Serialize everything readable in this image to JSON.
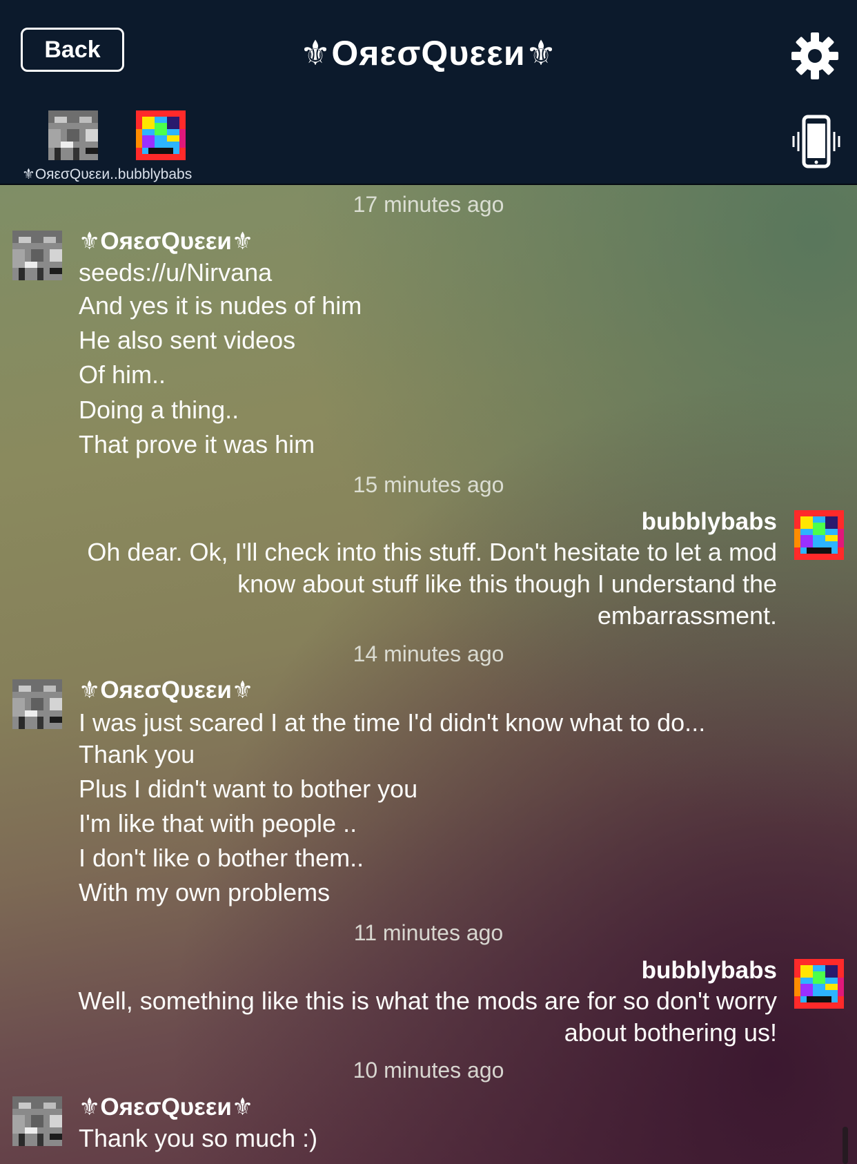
{
  "header": {
    "back_label": "Back",
    "title": "⚜OяεσQυεεи⚜",
    "settings_icon": "gear-icon",
    "vibrate_icon": "phone-vibrate-icon",
    "members_label": "⚜OяεσQυεεи..bubblybabs"
  },
  "messages": [
    {
      "time": "17 minutes ago",
      "sender": "⚜OяεσQυεεи⚜",
      "side": "left",
      "lines": [
        "seeds://u/Nirvana",
        "And yes it is nudes of him",
        "He also sent videos",
        "Of him..",
        "Doing a thing..",
        "That prove it was him"
      ]
    },
    {
      "time": "15 minutes ago",
      "sender": "bubblybabs",
      "side": "right",
      "lines": [
        "Oh dear.  Ok, I'll check into this stuff.  Don't hesitate to let a mod",
        "know about stuff like this though I understand the",
        "embarrassment."
      ]
    },
    {
      "time": "14 minutes ago",
      "sender": "⚜OяεσQυεεи⚜",
      "side": "left",
      "lines": [
        "I was just scared I at the time I'd didn't know what to do...",
        "Thank you",
        "Plus I didn't want to bother you",
        "I'm like that with people ..",
        "I don't like o bother them..",
        "With my own problems"
      ]
    },
    {
      "time": "11 minutes ago",
      "sender": "bubblybabs",
      "side": "right",
      "lines": [
        "Well, something like this is what the mods are for so don't worry",
        "about bothering us!"
      ]
    },
    {
      "time": "10 minutes ago",
      "sender": "⚜OяεσQυεεи⚜",
      "side": "left",
      "lines": [
        "Thank you so much :)"
      ]
    }
  ]
}
